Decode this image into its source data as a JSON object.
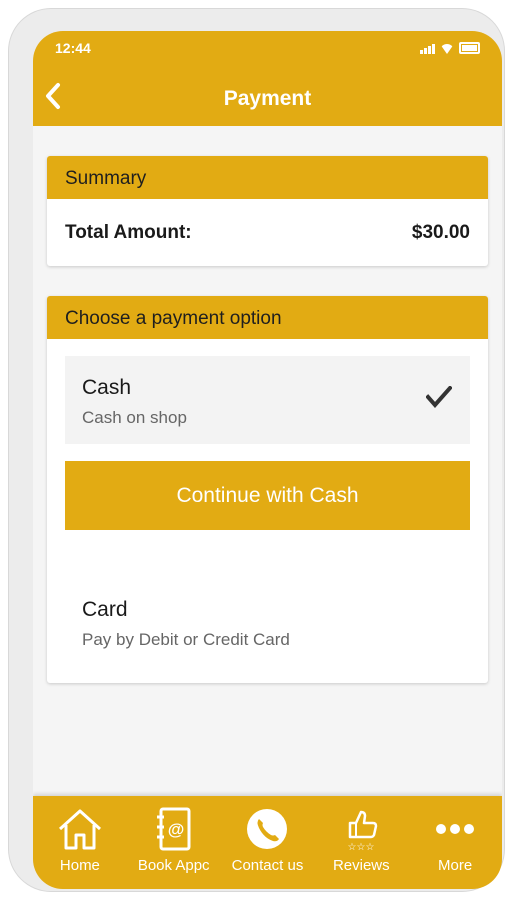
{
  "status_bar": {
    "time": "12:44"
  },
  "header": {
    "title": "Payment"
  },
  "summary": {
    "heading": "Summary",
    "total_label": "Total Amount:",
    "total_value": "$30.00"
  },
  "payment": {
    "heading": "Choose a payment option",
    "options": [
      {
        "title": "Cash",
        "subtitle": "Cash on shop",
        "selected": true
      },
      {
        "title": "Card",
        "subtitle": "Pay by Debit or Credit Card",
        "selected": false
      }
    ],
    "continue_label": "Continue with Cash"
  },
  "bottom_nav": {
    "items": [
      {
        "label": "Home",
        "icon": "home-icon"
      },
      {
        "label": "Book Appc",
        "icon": "address-book-icon"
      },
      {
        "label": "Contact us",
        "icon": "phone-icon"
      },
      {
        "label": "Reviews",
        "icon": "thumbs-up-stars-icon"
      },
      {
        "label": "More",
        "icon": "more-dots-icon"
      }
    ]
  },
  "colors": {
    "accent": "#e2ab13",
    "background": "#f5f5f5",
    "text": "#1a1a1a"
  }
}
